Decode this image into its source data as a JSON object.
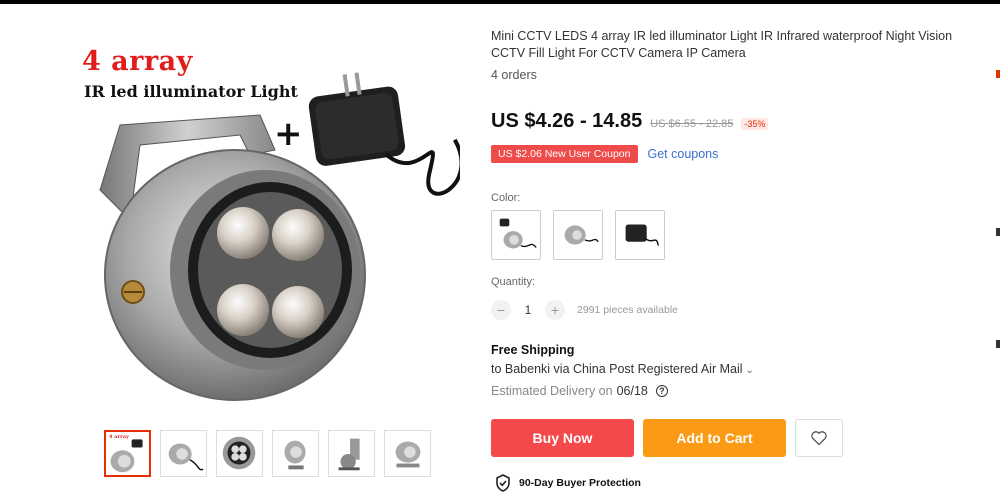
{
  "gallery": {
    "hero_title": "4 array",
    "hero_subtitle": "IR led illuminator Light",
    "hero_plus": "+",
    "thumbnail_label": "4 array"
  },
  "product": {
    "title": "Mini CCTV LEDS 4 array IR led illuminator Light IR Infrared waterproof Night Vision CCTV Fill Light For CCTV Camera IP Camera",
    "orders": "4 orders",
    "price": "US $4.26 - 14.85",
    "old_price": "US $6.55 - 22.85",
    "discount": "-35%",
    "coupon": "US $2.06 New User Coupon",
    "get_coupons": "Get coupons",
    "color_label": "Color:",
    "quantity_label": "Quantity:",
    "quantity_value": "1",
    "quantity_minus": "−",
    "quantity_plus": "+",
    "available": "2991 pieces available",
    "shipping_title": "Free Shipping",
    "ship_to": "to Babenki via China Post Registered Air Mail",
    "delivery_label": "Estimated Delivery on",
    "delivery_date": "06/18",
    "help_icon_glyph": "?",
    "buy_now": "Buy Now",
    "add_to_cart": "Add to Cart",
    "protection": "90-Day Buyer Protection"
  },
  "colors": {
    "buy_now_bg": "#f4484b",
    "add_to_cart_bg": "#fb9a14",
    "coupon_bg": "#ef4b4b",
    "link": "#3b6fd1",
    "hero_title": "#e21b1b"
  }
}
